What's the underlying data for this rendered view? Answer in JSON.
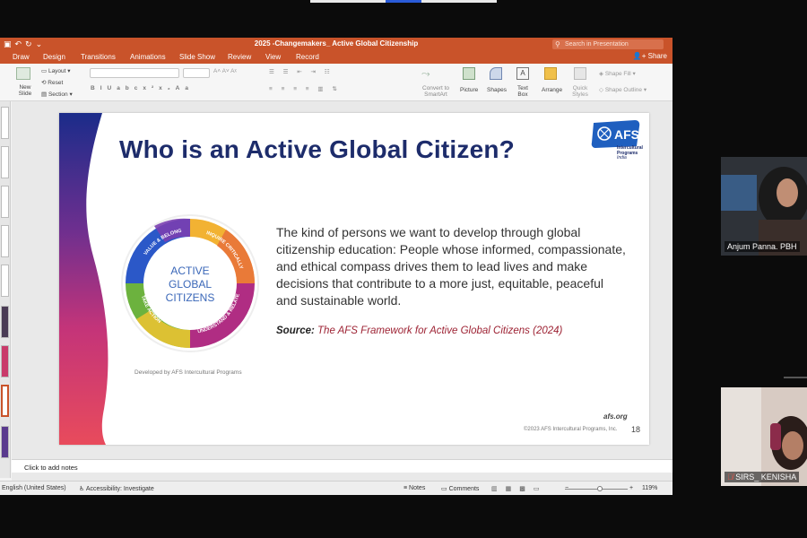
{
  "window": {
    "doc_title": "2025 -Changemakers_ Active Global Citizenship",
    "search_placeholder": "Search in Presentation",
    "share_label": "Share"
  },
  "tabs": [
    "Draw",
    "Design",
    "Transitions",
    "Animations",
    "Slide Show",
    "Review",
    "View",
    "Record"
  ],
  "ribbon": {
    "new_slide": "New Slide",
    "layout": "Layout",
    "reset": "Reset",
    "section": "Section",
    "convert": "Convert to SmartArt",
    "picture": "Picture",
    "shapes": "Shapes",
    "text_box": "Text Box",
    "arrange": "Arrange",
    "quick_styles": "Quick Styles",
    "shape_fill": "Shape Fill",
    "shape_outline": "Shape Outline"
  },
  "slide": {
    "title": "Who is an Active Global Citizen?",
    "body": "The kind of persons we want to develop through global citizenship education: People whose informed, compassionate, and ethical compass drives them to lead lives and make decisions that contribute to a more just, equitable, peaceful and sustainable world.",
    "source_label": "Source:",
    "source_text": "The AFS Framework for Active Global Citizens (2024)",
    "developed_by": "Developed by AFS Intercultural Programs",
    "afs_org": "afs.org",
    "copyright": "©2023 AFS Intercultural Programs, Inc.",
    "number": "18",
    "logo_text": "AFS",
    "logo_sub1": "Intercultural",
    "logo_sub2": "Programs",
    "logo_sub3": "India",
    "circle_center": [
      "ACTIVE",
      "GLOBAL",
      "CITIZENS"
    ],
    "circle_segments": [
      "VALUE & BELONG",
      "INQUIRE CRITICALLY",
      "UNDERSTAND & RELATE",
      "TAKE ACTION"
    ]
  },
  "notes_placeholder": "Click to add notes",
  "status": {
    "language": "English (United States)",
    "accessibility": "Accessibility: Investigate",
    "notes": "Notes",
    "comments": "Comments",
    "zoom": "119%"
  },
  "participants": [
    {
      "name": "Anjum Panna. PBH"
    },
    {
      "name": "SIRS_ KENISHA"
    }
  ],
  "colors": {
    "accent": "#c9532a",
    "title_navy": "#1d2c6b",
    "source_red": "#9d2233"
  }
}
